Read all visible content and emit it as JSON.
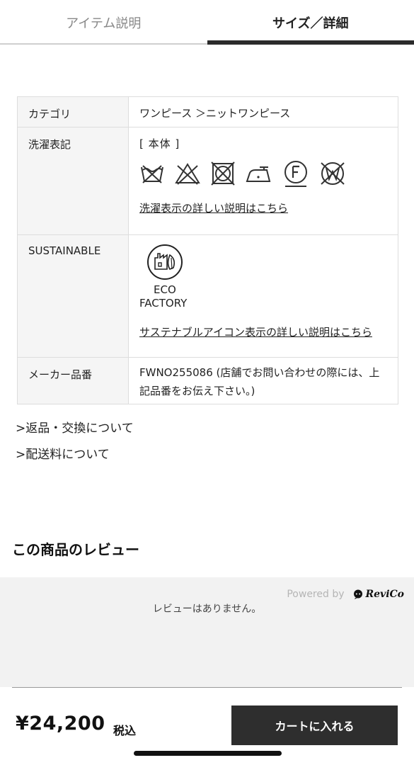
{
  "tabs": [
    {
      "label": "アイテム説明",
      "active": false
    },
    {
      "label": "サイズ／詳細",
      "active": true
    }
  ],
  "specs": {
    "category_label": "カテゴリ",
    "category_value": "ワンピース ＞ニットワンピース",
    "wash_label": "洗濯表記",
    "wash_part": "[ 本体 ]",
    "wash_icons": [
      "no-wash-icon",
      "no-bleach-icon",
      "no-tumble-dry-icon",
      "iron-low-icon",
      "dry-clean-f-icon",
      "no-wet-clean-icon"
    ],
    "wash_link": "洗濯表示の詳しい説明はこちら",
    "sustainable_label": "SUSTAINABLE",
    "eco_line1": "ECO",
    "eco_line2": "FACTORY",
    "sustainable_link": "サステナブルアイコン表示の詳しい説明はこちら",
    "maker_label": "メーカー品番",
    "maker_value": "FWNO255086 (店舗でお問い合わせの際には、上記品番をお伝え下さい。)"
  },
  "links": {
    "returns": ">返品・交換について",
    "shipping": ">配送料について"
  },
  "review": {
    "title": "この商品のレビュー",
    "powered_by": "Powered by",
    "brand": "ReviCo",
    "empty_message": "レビューはありません。"
  },
  "purchase": {
    "price": "¥24,200",
    "tax": "税込",
    "cart_button": "カートに入れる"
  }
}
